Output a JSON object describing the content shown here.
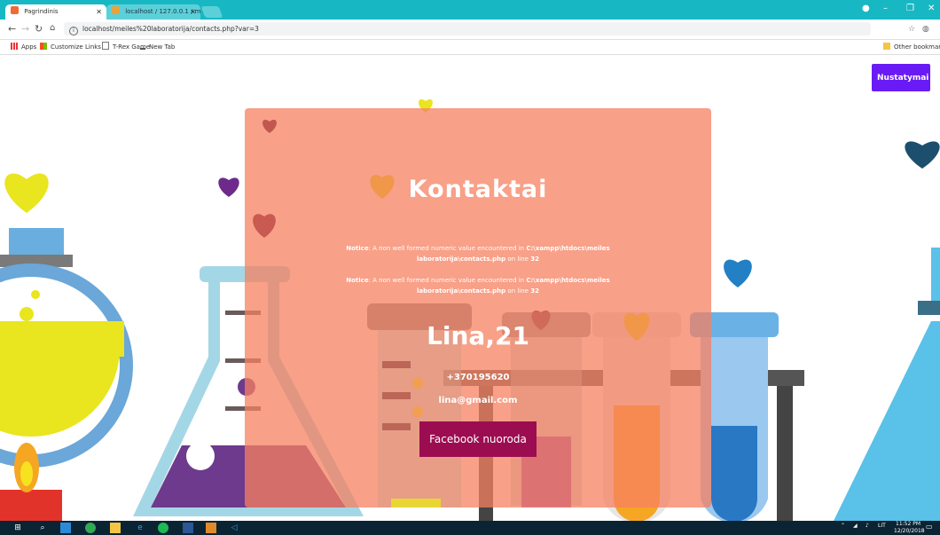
{
  "browser": {
    "tabs": [
      {
        "title": "Pagrindinis",
        "favicon_color": "#f06a35"
      },
      {
        "title": "localhost / 127.0.0.1 / m",
        "favicon_color": "#e8a33d"
      }
    ],
    "url": "localhost/meiles%20laboratorija/contacts.php?var=3",
    "bookmarks": [
      {
        "label": "Apps",
        "icon": "apps-grid-icon"
      },
      {
        "label": "Customize Links",
        "icon": "windows-logo-icon"
      },
      {
        "label": "T-Rex Game",
        "icon": "page-icon"
      },
      {
        "label": "New Tab",
        "icon": "download-icon"
      }
    ],
    "other_bookmarks": "Other bookmarks"
  },
  "page": {
    "settings_button": "Nustatymai",
    "title": "Kontaktai",
    "notices": [
      {
        "label": "Notice",
        "text_before": ": A non well formed numeric value encountered in ",
        "path": "C:\\xampp\\htdocs\\meiles laboratorija\\contacts.php",
        "text_after": " on line ",
        "line": "32"
      },
      {
        "label": "Notice",
        "text_before": ": A non well formed numeric value encountered in ",
        "path": "C:\\xampp\\htdocs\\meiles laboratorija\\contacts.php",
        "text_after": " on line ",
        "line": "32"
      }
    ],
    "person": "Lina,21",
    "phone": "+370195620",
    "email": "lina@gmail.com",
    "facebook_button": "Facebook nuoroda",
    "colors": {
      "card": "#f68060",
      "button_purple": "#6a1bf5",
      "facebook": "#9b0d50"
    }
  },
  "taskbar": {
    "tray": {
      "lang": "LIT",
      "time": "11:52 PM",
      "date": "12/20/2018"
    }
  }
}
